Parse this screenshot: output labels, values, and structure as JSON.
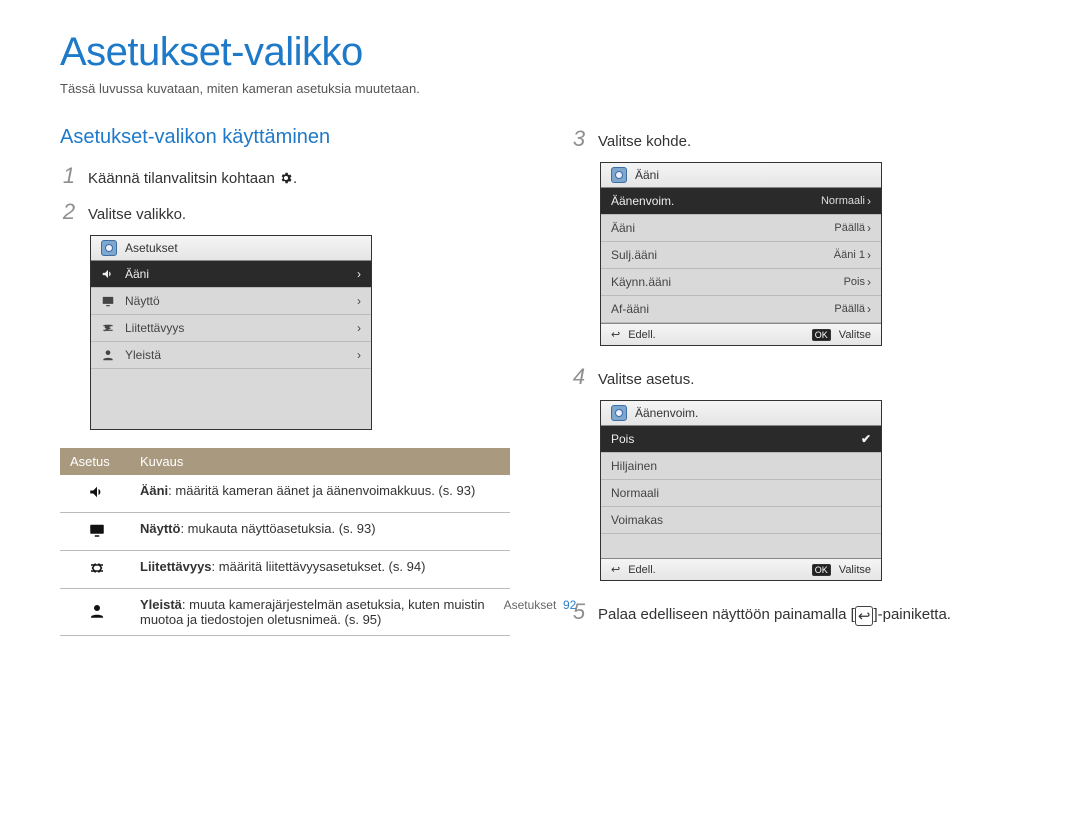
{
  "title": "Asetukset-valikko",
  "intro": "Tässä luvussa kuvataan, miten kameran asetuksia muutetaan.",
  "section_heading": "Asetukset-valikon käyttäminen",
  "steps": {
    "s1_pre": "Käännä tilanvalitsin kohtaan ",
    "s1_post": ".",
    "s2": "Valitse valikko.",
    "s3": "Valitse kohde.",
    "s4": "Valitse asetus.",
    "s5_pre": "Palaa edelliseen näyttöön painamalla [",
    "s5_post": "]-painiketta."
  },
  "nums": {
    "n1": "1",
    "n2": "2",
    "n3": "3",
    "n4": "4",
    "n5": "5"
  },
  "screen1": {
    "header": "Asetukset",
    "items": [
      {
        "label": "Ääni",
        "selected": true
      },
      {
        "label": "Näyttö"
      },
      {
        "label": "Liitettävyys"
      },
      {
        "label": "Yleistä"
      }
    ]
  },
  "desc_table": {
    "col1": "Asetus",
    "col2": "Kuvaus",
    "rows": [
      {
        "bold": "Ääni",
        "rest": ": määritä kameran äänet ja äänenvoimakkuus. (s. 93)"
      },
      {
        "bold": "Näyttö",
        "rest": ": mukauta näyttöasetuksia. (s. 93)"
      },
      {
        "bold": "Liitettävyys",
        "rest": ": määritä liitettävyysasetukset. (s. 94)"
      },
      {
        "bold": "Yleistä",
        "rest": ": muuta kamerajärjestelmän asetuksia, kuten muistin muotoa ja tiedostojen oletusnimeä. (s. 95)"
      }
    ]
  },
  "screen3": {
    "header": "Ääni",
    "rows": [
      {
        "label": "Äänenvoim.",
        "val": "Normaali",
        "selected": true
      },
      {
        "label": "Ääni",
        "val": "Päällä"
      },
      {
        "label": "Sulj.ääni",
        "val": "Ääni 1"
      },
      {
        "label": "Käynn.ääni",
        "val": "Pois"
      },
      {
        "label": "Af-ääni",
        "val": "Päällä"
      }
    ],
    "ftr_prev": "Edell.",
    "ftr_ok": "OK",
    "ftr_sel": "Valitse"
  },
  "screen4": {
    "header": "Äänenvoim.",
    "rows": [
      {
        "label": "Pois",
        "selected": true,
        "check": true
      },
      {
        "label": "Hiljainen"
      },
      {
        "label": "Normaali"
      },
      {
        "label": "Voimakas"
      }
    ],
    "ftr_prev": "Edell.",
    "ftr_ok": "OK",
    "ftr_sel": "Valitse"
  },
  "footer": {
    "section": "Asetukset",
    "page": "92"
  },
  "icons": {
    "back_arrow": "↩"
  }
}
